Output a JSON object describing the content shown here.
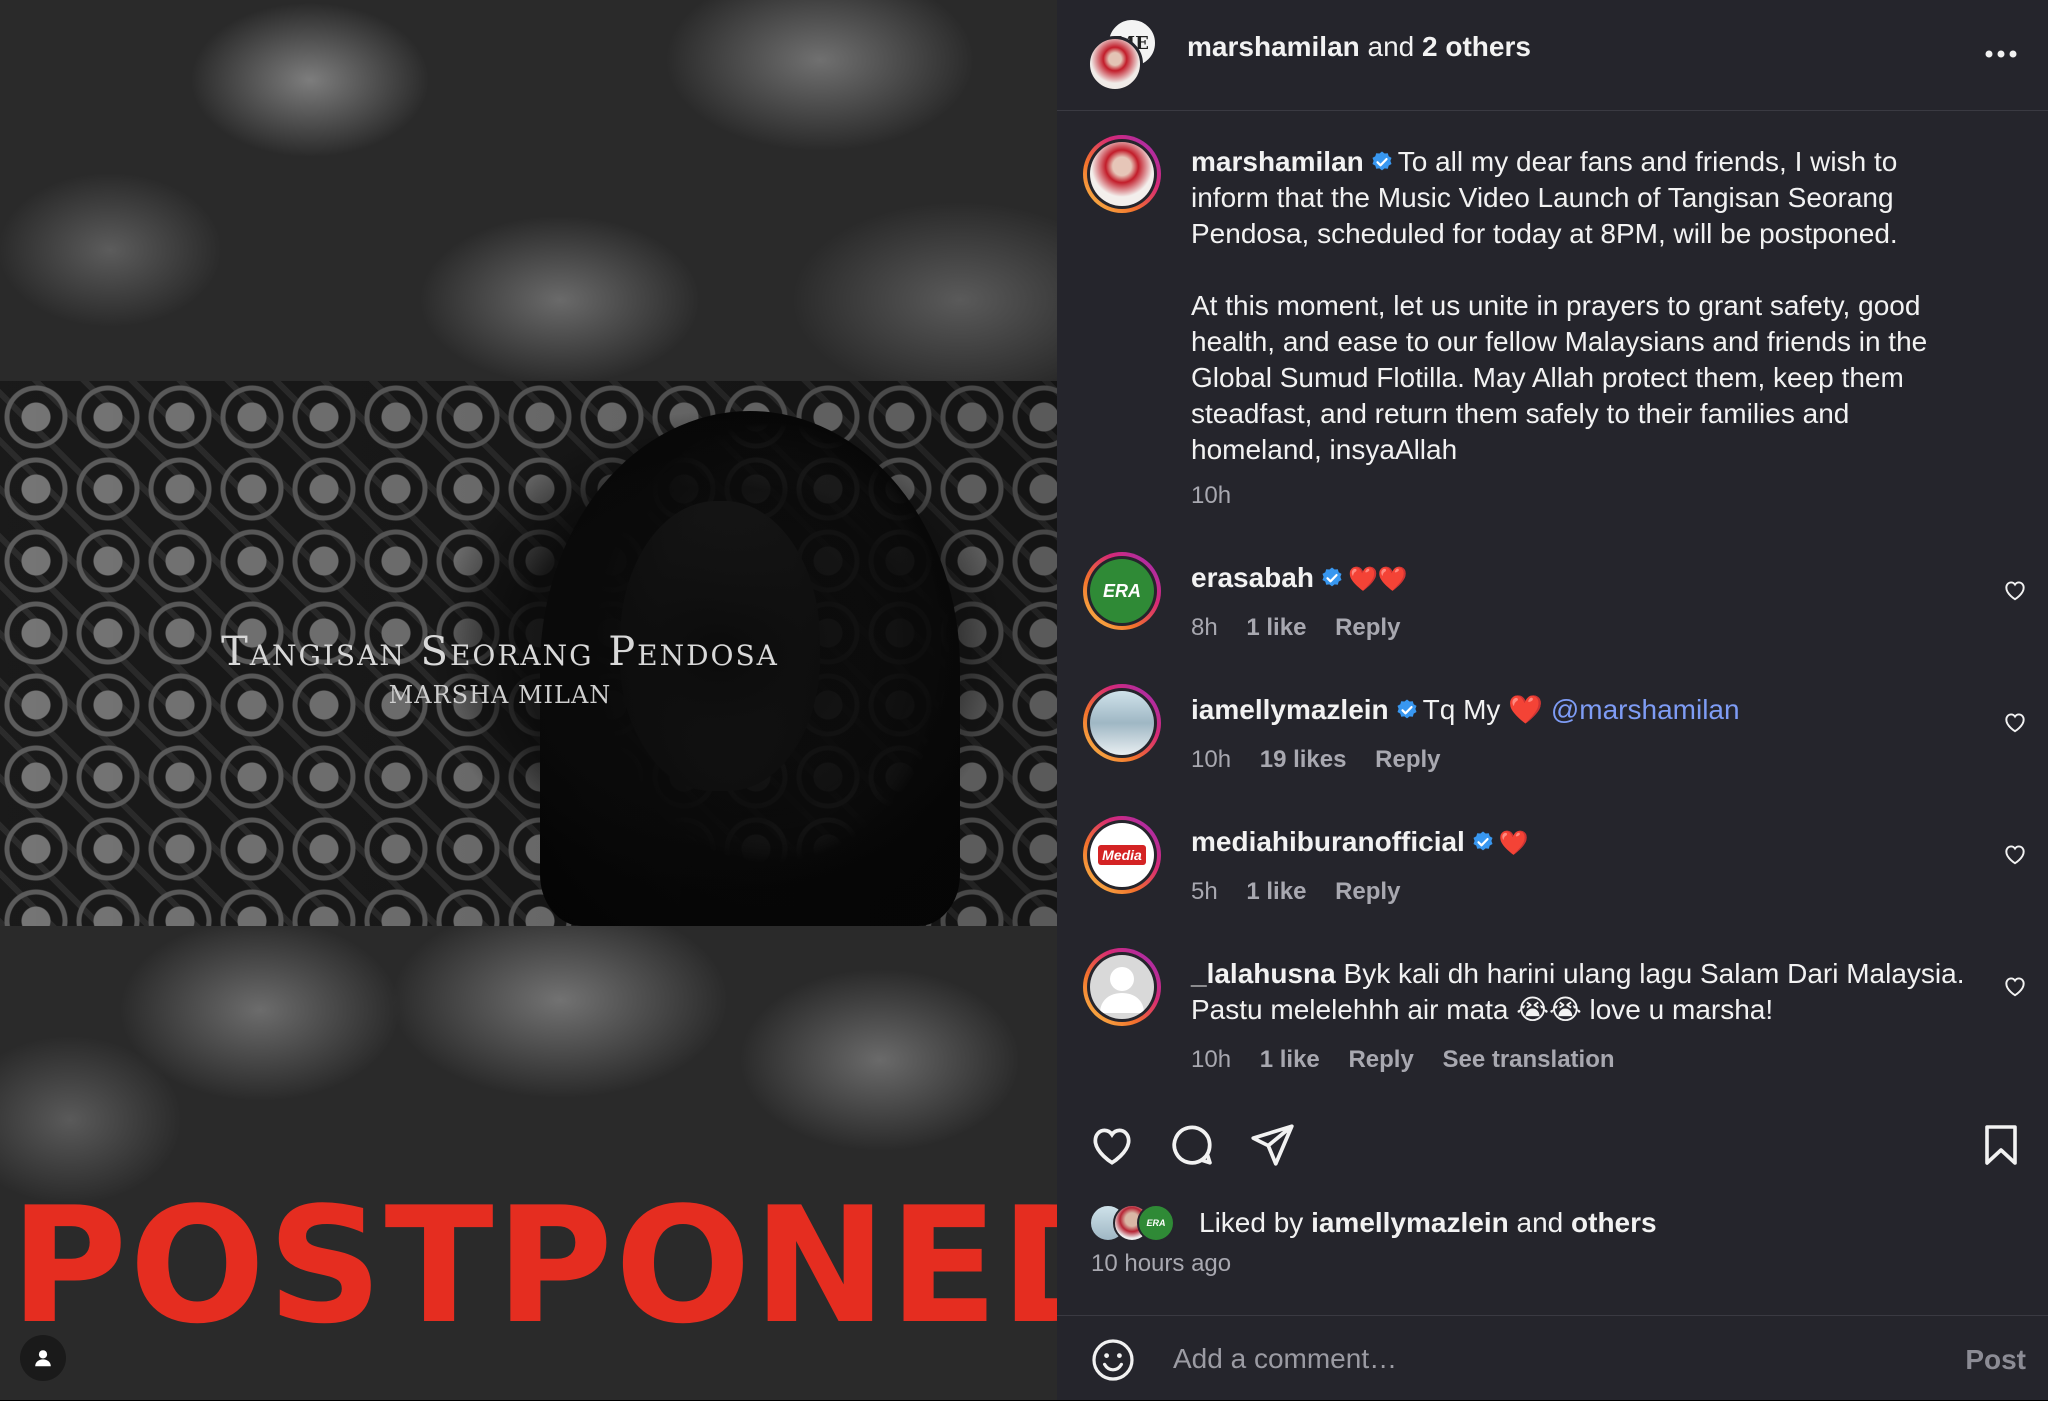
{
  "media": {
    "video_title": "Tangisan Seorang Pendosa",
    "video_artist": "MARSHA MILAN",
    "overlay_text": "POSTPONED",
    "tag_icon": "user-tag-icon"
  },
  "header": {
    "author": "marshamilan",
    "connector": "and",
    "others": "2 others",
    "collab_avatar_text": "ME",
    "more_icon": "more-horizontal-icon"
  },
  "caption": {
    "username": "marshamilan",
    "paragraph1": "To all my dear fans and friends, I wish to inform that the Music Video Launch of Tangisan Seorang Pendosa, scheduled for today at 8PM, will be postponed.",
    "paragraph2": "At this moment, let us unite in prayers to grant safety, good health, and ease to our fellow Malaysians and friends in the Global Sumud Flotilla. May Allah protect them, keep them steadfast, and return them safely to their families and homeland, insyaAllah",
    "time": "10h"
  },
  "comments": [
    {
      "username": "erasabah",
      "avatar_text": "ERA",
      "text": "❤️❤️",
      "time": "8h",
      "likes": "1 like",
      "reply": "Reply"
    },
    {
      "username": "iamellymazlein",
      "text": "Tq My ❤️",
      "mention": "@marshamilan",
      "time": "10h",
      "likes": "19 likes",
      "reply": "Reply"
    },
    {
      "username": "mediahiburanofficial",
      "avatar_text": "Media",
      "text": "❤️",
      "time": "5h",
      "likes": "1 like",
      "reply": "Reply"
    },
    {
      "username": "_lalahusna",
      "text_line1": "Byk kali dh harini ulang lagu Salam Dari Malaysia.",
      "text_line2": "Pastu melelehhh air mata 😭😭 love u marsha!",
      "time": "10h",
      "likes": "1 like",
      "reply": "Reply",
      "translation": "See translation"
    }
  ],
  "actions": {
    "like_icon": "heart-icon",
    "comment_icon": "comment-icon",
    "share_icon": "send-icon",
    "save_icon": "bookmark-icon"
  },
  "likes": {
    "prefix": "Liked by",
    "user": "iamellymazlein",
    "connector": "and",
    "others": "others",
    "time_ago": "10 hours ago",
    "mini_avatar_text": "ERA"
  },
  "comment_input": {
    "placeholder": "Add a comment…",
    "post_label": "Post",
    "emoji_icon": "emoji-icon"
  },
  "colors": {
    "panel_bg": "#25252c",
    "accent_link": "#7e9cf5",
    "verified": "#3897f0",
    "postponed_red": "#e52d20"
  }
}
